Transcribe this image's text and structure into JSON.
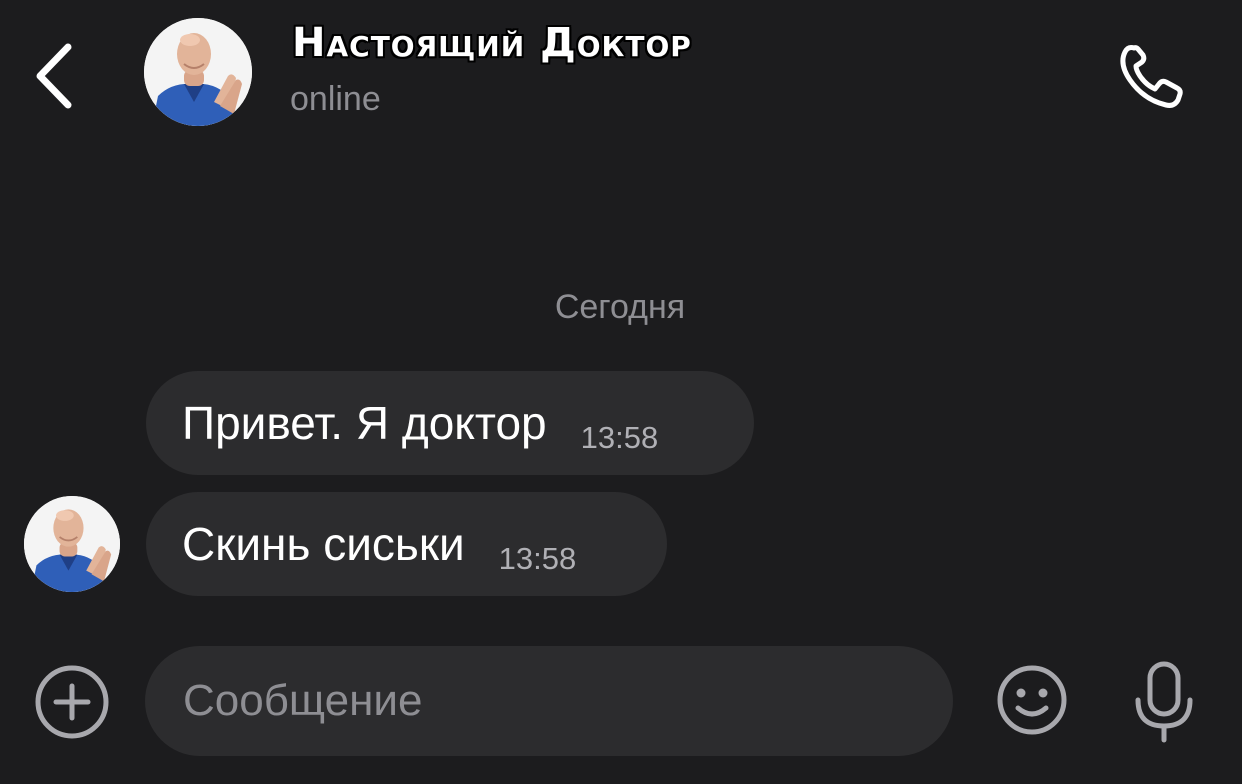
{
  "header": {
    "back_icon": "chevron-left-icon",
    "title": "Настоящий Доктор",
    "status": "online",
    "avatar_icon": "contact-avatar",
    "call_icon": "phone-icon"
  },
  "conversation": {
    "date_separator": "Сегодня",
    "messages": [
      {
        "text": "Привет. Я доктор",
        "time": "13:58",
        "direction": "incoming"
      },
      {
        "text": "Скинь сиськи",
        "time": "13:58",
        "direction": "incoming"
      }
    ]
  },
  "composer": {
    "placeholder": "Сообщение",
    "value": "",
    "attach_icon": "plus-circle-icon",
    "emoji_icon": "smiley-icon",
    "mic_icon": "microphone-icon"
  },
  "colors": {
    "background": "#1c1c1e",
    "bubble": "#2c2c2e",
    "secondary_text": "#8e8e93",
    "avatar_shirt": "#2f5fb8"
  }
}
